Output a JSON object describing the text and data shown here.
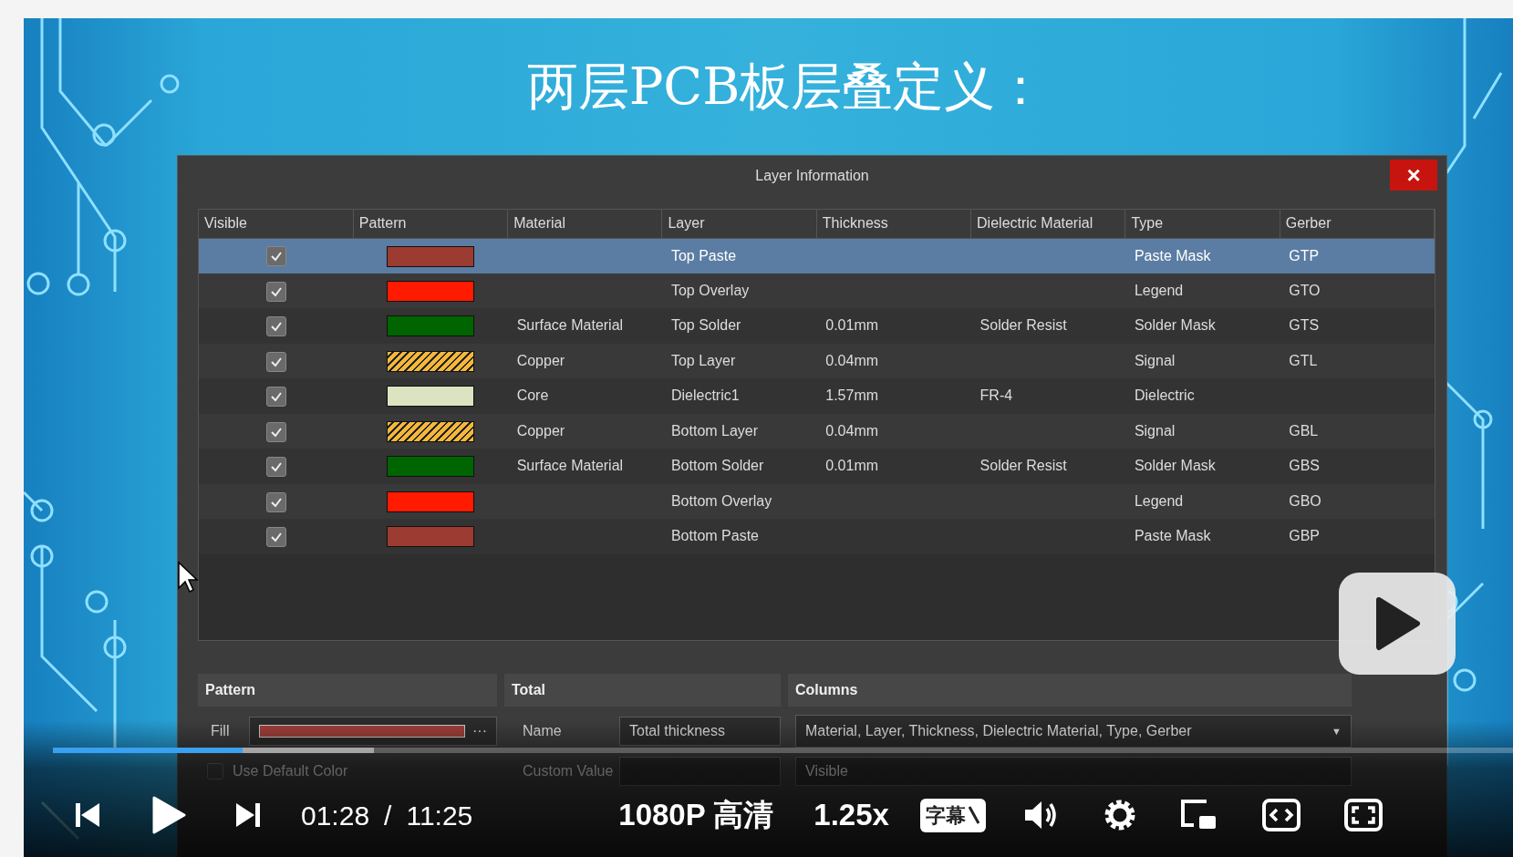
{
  "slide": {
    "title": "两层PCB板层叠定义："
  },
  "dialog": {
    "title": "Layer Information",
    "close": "×",
    "columns": [
      "Visible",
      "Pattern",
      "Material",
      "Layer",
      "Thickness",
      "Dielectric Material",
      "Type",
      "Gerber"
    ],
    "rows": [
      {
        "selected": true,
        "visible": true,
        "pattern": {
          "kind": "solid",
          "color": "#9c3b31"
        },
        "material": "",
        "layer": "Top Paste",
        "thickness": "",
        "dielectric_material": "",
        "type": "Paste Mask",
        "gerber": "GTP"
      },
      {
        "selected": false,
        "visible": true,
        "pattern": {
          "kind": "solid",
          "color": "#ff1a00"
        },
        "material": "",
        "layer": "Top Overlay",
        "thickness": "",
        "dielectric_material": "",
        "type": "Legend",
        "gerber": "GTO"
      },
      {
        "selected": false,
        "visible": true,
        "pattern": {
          "kind": "solid",
          "color": "#006400"
        },
        "material": "Surface Material",
        "layer": "Top Solder",
        "thickness": "0.01mm",
        "dielectric_material": "Solder Resist",
        "type": "Solder Mask",
        "gerber": "GTS"
      },
      {
        "selected": false,
        "visible": true,
        "pattern": {
          "kind": "hatched",
          "color": "#f5b73a"
        },
        "material": "Copper",
        "layer": "Top Layer",
        "thickness": "0.04mm",
        "dielectric_material": "",
        "type": "Signal",
        "gerber": "GTL"
      },
      {
        "selected": false,
        "visible": true,
        "pattern": {
          "kind": "solid",
          "color": "#dce3c0"
        },
        "material": "Core",
        "layer": "Dielectric1",
        "thickness": "1.57mm",
        "dielectric_material": "FR-4",
        "type": "Dielectric",
        "gerber": ""
      },
      {
        "selected": false,
        "visible": true,
        "pattern": {
          "kind": "hatched",
          "color": "#f5b73a"
        },
        "material": "Copper",
        "layer": "Bottom Layer",
        "thickness": "0.04mm",
        "dielectric_material": "",
        "type": "Signal",
        "gerber": "GBL"
      },
      {
        "selected": false,
        "visible": true,
        "pattern": {
          "kind": "solid",
          "color": "#006400"
        },
        "material": "Surface Material",
        "layer": "Bottom Solder",
        "thickness": "0.01mm",
        "dielectric_material": "Solder Resist",
        "type": "Solder Mask",
        "gerber": "GBS"
      },
      {
        "selected": false,
        "visible": true,
        "pattern": {
          "kind": "solid",
          "color": "#ff1a00"
        },
        "material": "",
        "layer": "Bottom Overlay",
        "thickness": "",
        "dielectric_material": "",
        "type": "Legend",
        "gerber": "GBO"
      },
      {
        "selected": false,
        "visible": true,
        "pattern": {
          "kind": "solid",
          "color": "#9c3b31"
        },
        "material": "",
        "layer": "Bottom Paste",
        "thickness": "",
        "dielectric_material": "",
        "type": "Paste Mask",
        "gerber": "GBP"
      }
    ],
    "pattern_panel": {
      "heading": "Pattern",
      "fill_label": "Fill",
      "fill": {
        "color": "#a0403a"
      },
      "more": "···",
      "use_default_color": {
        "label": "Use Default Color",
        "checked": false
      }
    },
    "total_panel": {
      "heading": "Total",
      "name_label": "Name",
      "name_value": "Total thickness",
      "custom_label": "Custom Value"
    },
    "columns_panel": {
      "heading": "Columns",
      "value": "Material, Layer, Thickness, Dielectric Material, Type, Gerber",
      "caret": "▼",
      "second_value": "Visible"
    }
  },
  "player": {
    "progress": {
      "level": 0.13
    },
    "buffer": {
      "level": 0.22
    },
    "time_current": "01:28",
    "separator": "/",
    "time_total": "11:25",
    "quality": "1080P 高清",
    "speed": "1.25x",
    "subtitle": "字幕"
  }
}
